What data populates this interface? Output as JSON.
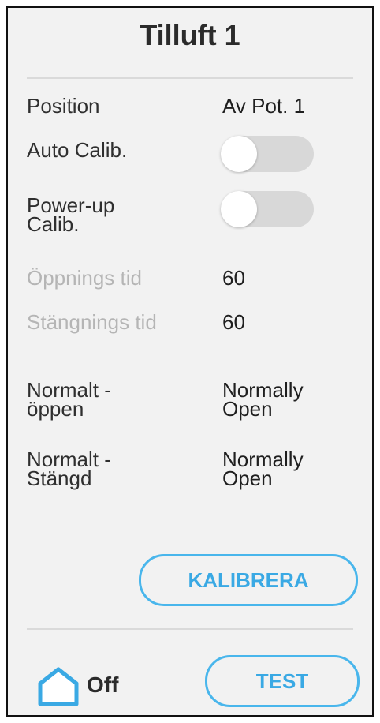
{
  "title": "Tilluft 1",
  "rows": [
    {
      "label": "Position",
      "value": "Av Pot. 1"
    },
    {
      "label": "Auto Calib.",
      "toggle_on": false
    },
    {
      "label": "Power-up Calib.",
      "toggle_on": false
    },
    {
      "label": "Öppnings tid",
      "value": "60"
    },
    {
      "label": "Stängnings tid",
      "value": "60"
    },
    {
      "label": "Normalt - öppen",
      "value": "Normally Open"
    },
    {
      "label": "Normalt - Stängd",
      "value": "Normally Open"
    }
  ],
  "buttons": {
    "calibrate": "KALIBRERA",
    "test": "TEST"
  },
  "footer": {
    "status": "Off",
    "icon": "home-icon"
  },
  "colors": {
    "accent": "#49b6ec",
    "background": "#f2f2f2",
    "muted_text": "#b5b5b5"
  }
}
